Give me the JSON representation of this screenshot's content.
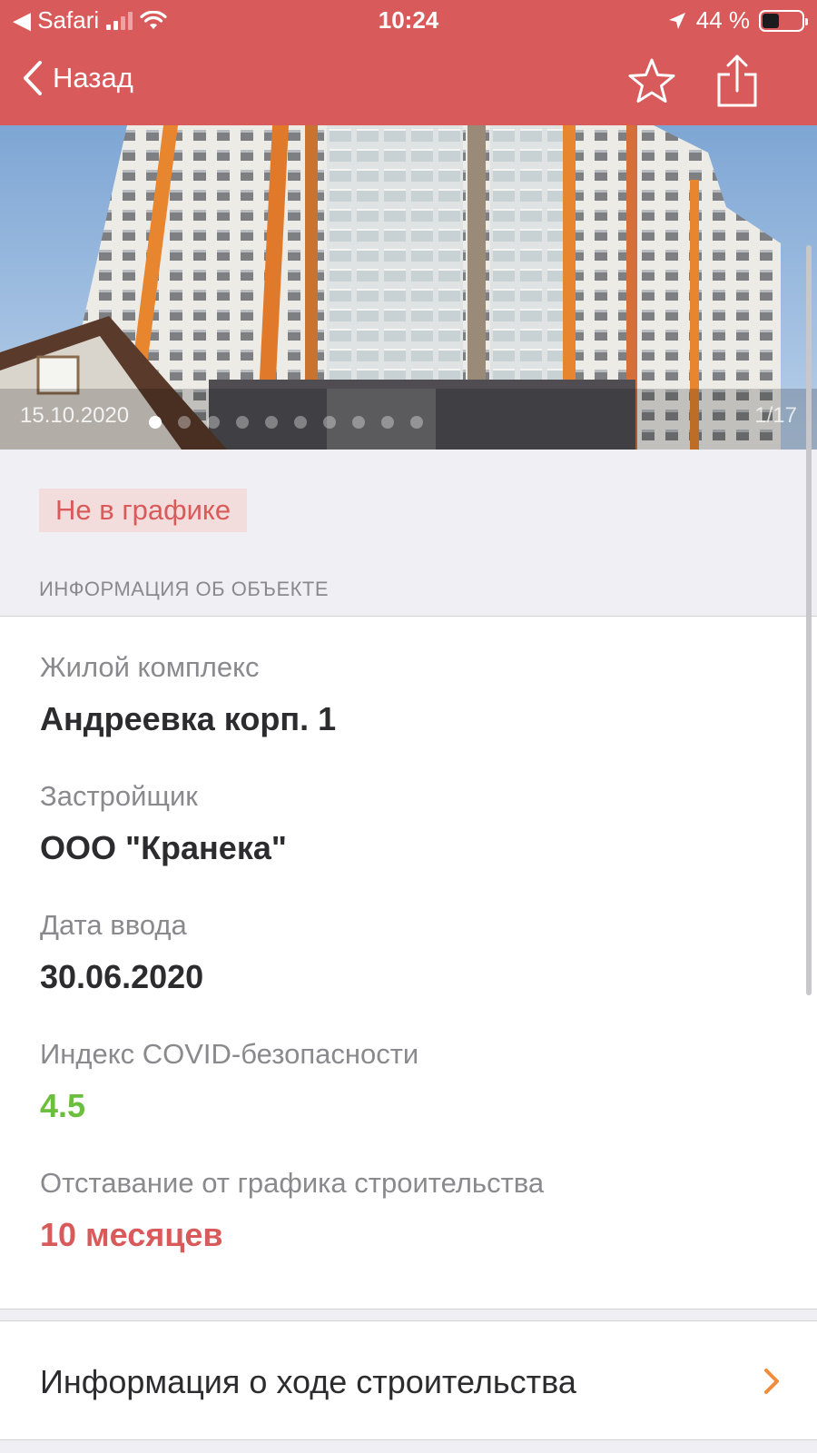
{
  "status_bar": {
    "carrier": "◀ Safari",
    "time": "10:24",
    "battery": "44 %",
    "battery_fraction": 0.44
  },
  "nav": {
    "back_label": "Назад",
    "icons": [
      "chevron-left-icon",
      "star-icon",
      "share-icon"
    ]
  },
  "photo": {
    "date": "15.10.2020",
    "counter": "1/17",
    "current_index": 1,
    "total": 17
  },
  "status_chip": "Не в графике",
  "section_header": "ИНФОРМАЦИЯ ОБ ОБЪЕКТЕ",
  "fields": [
    {
      "label": "Жилой комплекс",
      "value": "Андреевка корп. 1"
    },
    {
      "label": "Застройщик",
      "value": "ООО \"Кранека\""
    },
    {
      "label": "Дата ввода",
      "value": "30.06.2020"
    },
    {
      "label": "Индекс COVID-безопасности",
      "value": "4.5"
    },
    {
      "label": "Отставание от графика строительства",
      "value": "10 месяцев"
    }
  ],
  "link_row": {
    "label": "Информация о ходе строительства"
  },
  "colors": {
    "accent": "#d95a5a",
    "positive": "#6cbf3d",
    "chevron": "#f08c3a"
  }
}
